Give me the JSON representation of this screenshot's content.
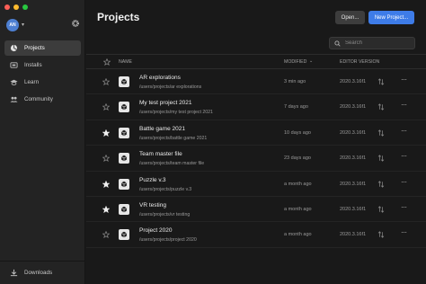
{
  "window": {
    "traffic_colors": [
      "#fe5f57",
      "#febc2e",
      "#28c840"
    ]
  },
  "account": {
    "initials": "AN"
  },
  "sidebar": {
    "items": [
      {
        "label": "Projects",
        "icon": "cube-icon",
        "active": true
      },
      {
        "label": "Installs",
        "icon": "installs-icon",
        "active": false
      },
      {
        "label": "Learn",
        "icon": "graduation-cap-icon",
        "active": false
      },
      {
        "label": "Community",
        "icon": "people-icon",
        "active": false
      }
    ],
    "downloads_label": "Downloads"
  },
  "header": {
    "title": "Projects",
    "open_label": "Open...",
    "new_label": "New Project..."
  },
  "search": {
    "placeholder": "Search",
    "value": ""
  },
  "table": {
    "columns": {
      "name": "NAME",
      "modified": "MODIFIED",
      "version": "EDITOR VERSION"
    },
    "rows": [
      {
        "name": "AR explorations",
        "path": "/users/projects/ar explorations",
        "modified": "3 min ago",
        "version": "2020.3.16f1",
        "starred": false
      },
      {
        "name": "My test project 2021",
        "path": "/users/projects/my test project 2021",
        "modified": "7 days ago",
        "version": "2020.3.16f1",
        "starred": false
      },
      {
        "name": "Battle game 2021",
        "path": "/users/projects/battle game 2021",
        "modified": "10 days ago",
        "version": "2020.3.16f1",
        "starred": true
      },
      {
        "name": "Team master file",
        "path": "/users/projects/team master file",
        "modified": "23 days ago",
        "version": "2020.3.16f1",
        "starred": false
      },
      {
        "name": "Puzzle v.3",
        "path": "/users/projects/puzzle v.3",
        "modified": "a month ago",
        "version": "2020.3.16f1",
        "starred": true
      },
      {
        "name": "VR testing",
        "path": "/users/projects/vr testing",
        "modified": "a month ago",
        "version": "2020.3.16f1",
        "starred": true
      },
      {
        "name": "Project 2020",
        "path": "/users/projects/project 2020",
        "modified": "a month ago",
        "version": "2020.3.16f1",
        "starred": false
      }
    ]
  },
  "colors": {
    "accent": "#3e7ce8",
    "sidebar_bg": "#232323",
    "main_bg": "#191919"
  }
}
